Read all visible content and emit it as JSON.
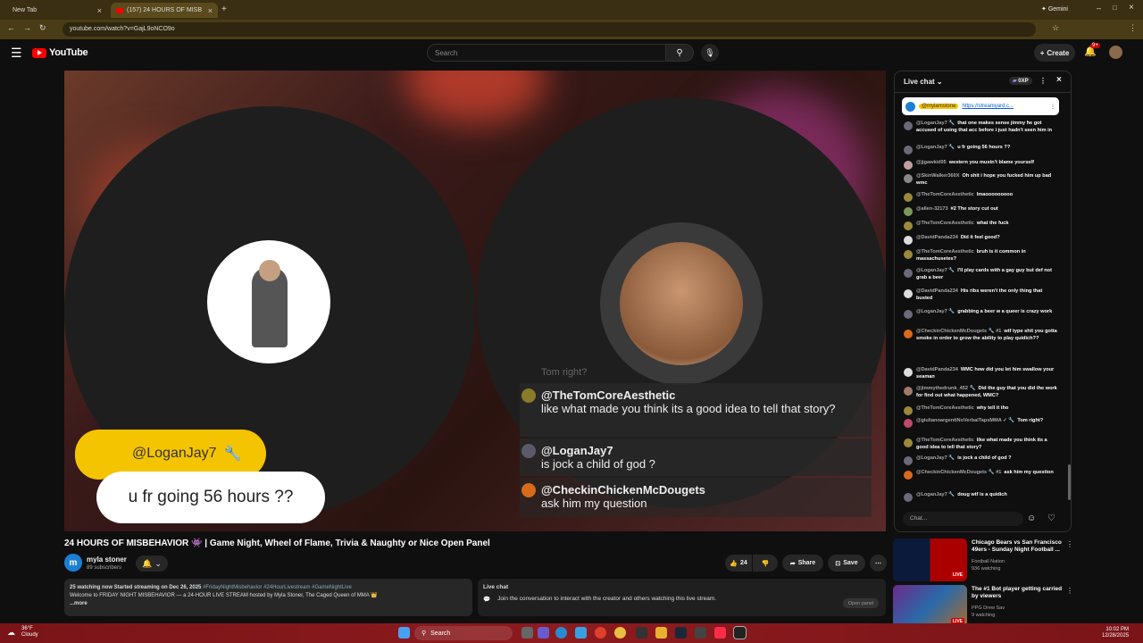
{
  "browser": {
    "tabs": [
      {
        "label": "New Tab"
      },
      {
        "label": "(157) 24 HOURS OF MISB"
      }
    ],
    "new_tab_glyph": "+",
    "gemini_label": "Gemini",
    "url": "youtube.com/watch?v=GajL9oNCO9o"
  },
  "yt": {
    "logo_text": "YouTube",
    "search_placeholder": "Search",
    "create_label": "Create",
    "notif_count": "9+"
  },
  "video_overlay": {
    "caption_user": "@LoganJay7",
    "caption_text": "u fr going 56 hours ??",
    "faded_text": "Tom right?",
    "messages": [
      {
        "user": "@TheTomCoreAesthetic",
        "text": "like what made you think its a good idea to tell that story?",
        "avatar_color": "#8a7a2a"
      },
      {
        "user": "@LoganJay7",
        "text": "is jock a child of god ?",
        "avatar_color": "#5a5a6a"
      },
      {
        "user": "@CheckinChickenMcDougets",
        "text": "ask him my question",
        "avatar_color": "#d86a1a"
      }
    ]
  },
  "video_info": {
    "title": "24 HOURS OF MISBEHAVIOR 👾 | Game Night, Wheel of Flame, Trivia & Naughty or Nice Open Panel",
    "channel_initial": "m",
    "channel": "myla stoner",
    "subscribers": "89 subscribers",
    "likes": "24",
    "share_label": "Share",
    "save_label": "Save",
    "desc_stats": "25 watching now  Started streaming on Dec 26, 2025",
    "desc_tags": "#FridayNightMisbehavior #24HourLivestream #GameNightLive",
    "desc_text": "Welcome to FRIDAY NIGHT MISBEHAVIOR — a 24-HOUR LIVE STREAM hosted by Myla Stoner, The Caged Queen of MMA 👑",
    "more_label": "...more",
    "live_chat_title": "Live chat",
    "live_chat_text": "Join the conversation to interact with the creator and others watching this live stream.",
    "open_panel_label": "Open panel"
  },
  "chat": {
    "header": "Live chat",
    "xp_label": "0XP",
    "pinned_user": "@mylamstone",
    "pinned_link": "https://streamyard.c...",
    "input_placeholder": "Chat...",
    "messages": [
      {
        "user": "@LoganJay7 🔧",
        "text": "that one makes sense jimmy he got accused of using that acc before i just hadn't seen him in",
        "color": "#6a6a7a"
      },
      {
        "user": "@LoganJay7 🔧",
        "text": "u fr going 56 hours ??",
        "color": "#6a6a7a"
      },
      {
        "user": "@jjgawkid95",
        "text": "western you mustn't blame yourself",
        "color": "#c0a0a0"
      },
      {
        "user": "@SkinWalker360X",
        "text": "Oh shit i hope you fucked him up bad wmc",
        "color": "#888"
      },
      {
        "user": "@TheTomCoreAesthetic",
        "text": "lmaooooooooo",
        "color": "#9a8a3a"
      },
      {
        "user": "@allen-32173",
        "text": "#2  The story cut out",
        "color": "#7a9a5a"
      },
      {
        "user": "@TheTomCoreAesthetic",
        "text": "what the fuck",
        "color": "#9a8a3a"
      },
      {
        "user": "@DavidPanda234",
        "text": "Did it feel good?",
        "color": "#ddd"
      },
      {
        "user": "@TheTomCoreAesthetic",
        "text": "bruh is it common in massachusetes?",
        "color": "#9a8a3a"
      },
      {
        "user": "@LoganJay7 🔧",
        "text": "I'll play cards with a gay guy but def not grab a beer",
        "color": "#6a6a7a"
      },
      {
        "user": "@DavidPanda234",
        "text": "His ribs weren't the only thing that busted",
        "color": "#ddd"
      },
      {
        "user": "@LoganJay7 🔧",
        "text": "grabbing a beer w a queer is crazy work",
        "color": "#6a6a7a"
      },
      {
        "user": "@CheckinChickenMcDougets 🔧  #1",
        "text": "wtf type shit you gotta smoke in order to grow the ability to play quidich??",
        "color": "#d86a1a"
      },
      {
        "user": "@DavidPanda234",
        "text": "WMC how did you let him swallow your seaman",
        "color": "#ddd"
      },
      {
        "user": "@jimmythedrunk_452 🔧",
        "text": "Did the guy that you did the work for find out what happened, WMC?",
        "color": "#a07a6a"
      },
      {
        "user": "@TheTomCoreAesthetic",
        "text": "why tell it tho",
        "color": "#9a8a3a"
      },
      {
        "user": "@giulianoargentiNoVerbalTapsMMA ✓ 🔧",
        "text": "Tom right?",
        "color": "#c04a6a"
      },
      {
        "user": "@TheTomCoreAesthetic",
        "text": "like what made you think its a good idea to tell that story?",
        "color": "#9a8a3a"
      },
      {
        "user": "@LoganJay7 🔧",
        "text": "is jock a child of god ?",
        "color": "#6a6a7a"
      },
      {
        "user": "@CheckinChickenMcDougets 🔧  #1",
        "text": "ask him my question",
        "color": "#d86a1a"
      },
      {
        "user": "@LoganJay7 🔧",
        "text": "doug wtf is a quidich",
        "color": "#6a6a7a"
      }
    ]
  },
  "suggestions": [
    {
      "title": "Chicago Bears vs San Francisco 49ers - Sunday Night Football ...",
      "channel": "Football Nation",
      "meta": "936 watching",
      "live": "LIVE"
    },
    {
      "title": "The #1 Bot player getting carried by viewers",
      "channel": "PPG Drew Sav",
      "meta": "9 watching",
      "live": "LIVE"
    }
  ],
  "taskbar": {
    "temp": "36°F",
    "weather": "Cloudy",
    "search": "Search",
    "time": "10:02 PM",
    "date": "12/28/2025"
  }
}
